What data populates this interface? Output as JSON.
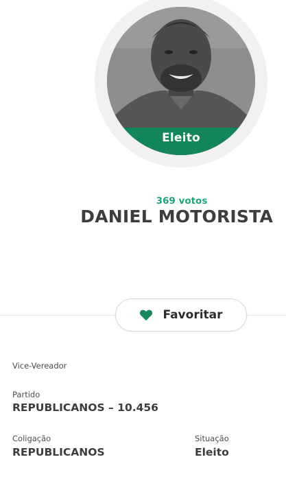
{
  "candidate": {
    "status_badge": "Eleito",
    "votes": "369 votos",
    "name": "DANIEL MOTORISTA"
  },
  "favorite_button": {
    "label": "Favoritar"
  },
  "details": {
    "role": "Vice-Vereador",
    "party_label": "Partido",
    "party_value": "REPUBLICANOS – 10.456",
    "coalition_label": "Coligação",
    "coalition_value": "REPUBLICANOS",
    "situation_label": "Situação",
    "situation_value": "Eleito"
  },
  "colors": {
    "accent_green": "#12855a",
    "votes_green": "#1fa377",
    "heart_green": "#16885b"
  },
  "icons": {
    "favorite": "heart-icon"
  }
}
